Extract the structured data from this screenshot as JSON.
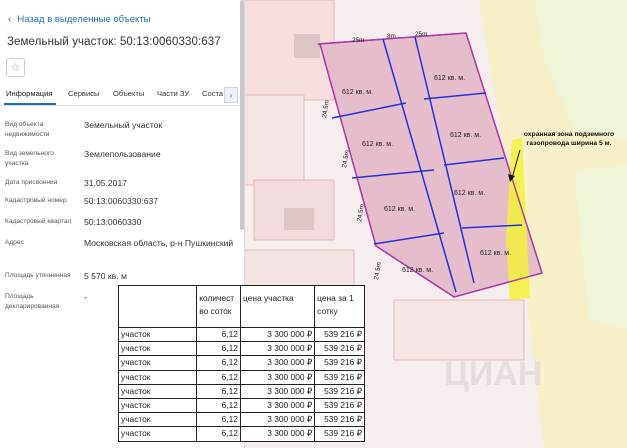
{
  "panel": {
    "back_label": "Назад в выделенные объекты",
    "title": "Земельный участок: 50:13:0060330:637",
    "tabs": [
      "Информация",
      "Сервисы",
      "Объекты",
      "Части ЗУ",
      "Соста"
    ],
    "active_tab": "Информация",
    "fields": [
      {
        "label": "Вид объекта недвижимости",
        "value": "Земельный участок"
      },
      {
        "label": "Вид земельного участка",
        "value": "Землепользование"
      },
      {
        "label": "Дата присвоения",
        "value": "31.05.2017"
      },
      {
        "label": "Кадастровый номер",
        "value": "50:13:0060330:637"
      },
      {
        "label": "Кадастровый квартал",
        "value": "50:13:0060330"
      },
      {
        "label": "Адрес",
        "value": "Московская область, р-н Пушкинский"
      },
      {
        "label": "Площадь уточненная",
        "value": "5 570 кв. м"
      },
      {
        "label": "Площадь декларированная",
        "value": "-"
      }
    ]
  },
  "map": {
    "dim_top_left": "25m",
    "dim_top_mid": "8m",
    "dim_top_right": "25m",
    "dim_side_1": "24.5m",
    "dim_side_2": "24.5m",
    "dim_side_3": "24.5m",
    "dim_side_4": "24.5m",
    "plot_label": "612 кв. м.",
    "annotation": "охранная зона подземного газопровода ширина 5 м.",
    "colors": {
      "plot_fill": "#e3b8c8",
      "plot_border": "#b03aa8",
      "divider": "#2630d6",
      "gas_zone": "#f2f23a",
      "road": "#f7f1c9"
    }
  },
  "table": {
    "headers": [
      "",
      "количест во соток",
      "цена участка",
      "цена за 1 сотку"
    ],
    "rows": [
      [
        "участок",
        "6,12",
        "3 300 000 ₽",
        "539 216 ₽"
      ],
      [
        "участок",
        "6,12",
        "3 300 000 ₽",
        "539 216 ₽"
      ],
      [
        "участок",
        "6,12",
        "3 300 000 ₽",
        "539 216 ₽"
      ],
      [
        "участок",
        "6,12",
        "3 300 000 ₽",
        "539 216 ₽"
      ],
      [
        "участок",
        "6,12",
        "3 300 000 ₽",
        "539 216 ₽"
      ],
      [
        "участок",
        "6,12",
        "3 300 000 ₽",
        "539 216 ₽"
      ],
      [
        "участок",
        "6,12",
        "3 300 000 ₽",
        "539 216 ₽"
      ],
      [
        "участок",
        "6,12",
        "3 300 000 ₽",
        "539 216 ₽"
      ]
    ]
  }
}
